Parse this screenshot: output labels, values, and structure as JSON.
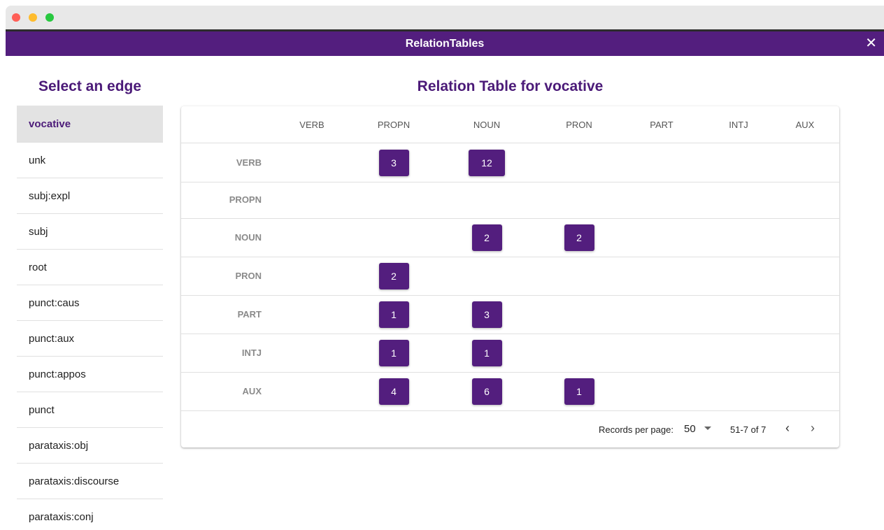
{
  "window": {
    "title": "RelationTables",
    "close_glyph": "✕"
  },
  "sidebar": {
    "title": "Select an edge",
    "items": [
      {
        "label": "vocative",
        "selected": true
      },
      {
        "label": "unk"
      },
      {
        "label": "subj:expl"
      },
      {
        "label": "subj"
      },
      {
        "label": "root"
      },
      {
        "label": "punct:caus"
      },
      {
        "label": "punct:aux"
      },
      {
        "label": "punct:appos"
      },
      {
        "label": "punct"
      },
      {
        "label": "parataxis:obj"
      },
      {
        "label": "parataxis:discourse"
      },
      {
        "label": "parataxis:conj"
      }
    ]
  },
  "main": {
    "title": "Relation Table for vocative",
    "columns": [
      "VERB",
      "PROPN",
      "NOUN",
      "PRON",
      "PART",
      "INTJ",
      "AUX"
    ],
    "rows": [
      {
        "label": "VERB",
        "cells": [
          null,
          3,
          12,
          null,
          null,
          null,
          null
        ]
      },
      {
        "label": "PROPN",
        "cells": [
          null,
          null,
          null,
          null,
          null,
          null,
          null
        ]
      },
      {
        "label": "NOUN",
        "cells": [
          null,
          null,
          2,
          2,
          null,
          null,
          null
        ]
      },
      {
        "label": "PRON",
        "cells": [
          null,
          2,
          null,
          null,
          null,
          null,
          null
        ]
      },
      {
        "label": "PART",
        "cells": [
          null,
          1,
          3,
          null,
          null,
          null,
          null
        ]
      },
      {
        "label": "INTJ",
        "cells": [
          null,
          1,
          1,
          null,
          null,
          null,
          null
        ]
      },
      {
        "label": "AUX",
        "cells": [
          null,
          4,
          6,
          1,
          null,
          null,
          null
        ]
      }
    ]
  },
  "pagination": {
    "records_label": "Records per page:",
    "records_value": "50",
    "range": "51-7 of 7",
    "prev_glyph": "‹",
    "next_glyph": "›"
  },
  "colors": {
    "brand": "#531e7e",
    "title": "#4b1a78"
  }
}
